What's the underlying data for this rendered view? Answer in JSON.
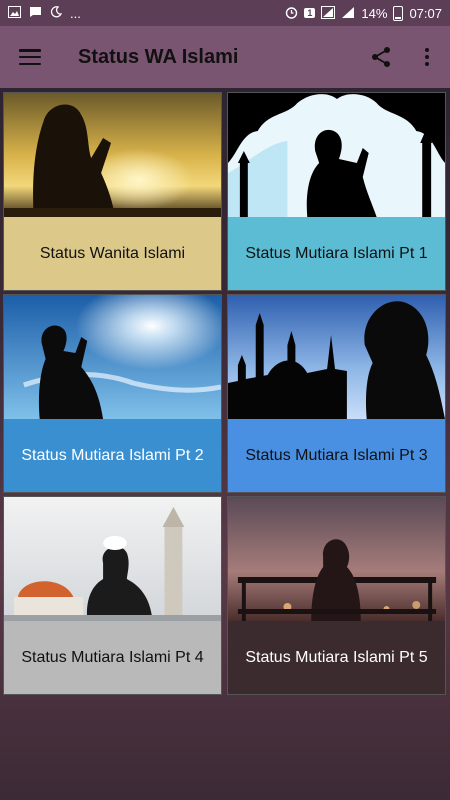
{
  "status_bar": {
    "left_icons": [
      "image-icon",
      "message-icon",
      "moon-icon"
    ],
    "more": "...",
    "battery": "14%",
    "time": "07:07"
  },
  "app_bar": {
    "title": "Status WA Islami",
    "menu_icon": "hamburger-icon",
    "share_icon": "share-icon",
    "more_icon": "more-vert-icon"
  },
  "cards": [
    {
      "label": "Status Wanita Islami",
      "label_bg": "#dcc98a",
      "label_color": "#111111",
      "image": "woman-praying-sunset"
    },
    {
      "label": "Status Mutiara Islami Pt 1",
      "label_bg": "#5bbcd3",
      "label_color": "#111111",
      "image": "man-praying-mosque-arch"
    },
    {
      "label": "Status Mutiara Islami Pt 2",
      "label_bg": "#3a8fd0",
      "label_color": "#ffffff",
      "image": "man-praying-sky"
    },
    {
      "label": "Status Mutiara Islami Pt 3",
      "label_bg": "#4a90e2",
      "label_color": "#111111",
      "image": "mosque-silhouette-prayer"
    },
    {
      "label": "Status Mutiara Islami Pt 4",
      "label_bg": "#b9b9b9",
      "label_color": "#111111",
      "image": "man-mosque-dome"
    },
    {
      "label": "Status Mutiara Islami Pt 5",
      "label_bg": "#3b2a2e",
      "label_color": "#ffffff",
      "image": "woman-bench-dusk"
    }
  ]
}
